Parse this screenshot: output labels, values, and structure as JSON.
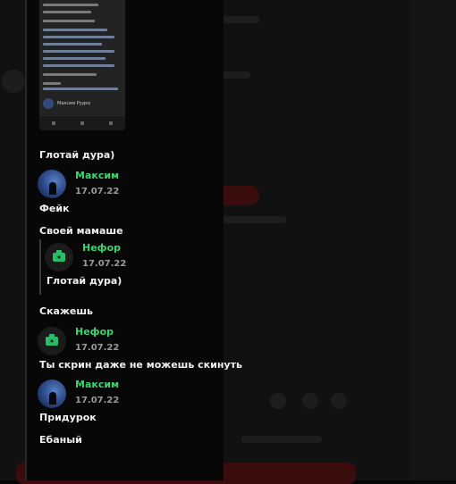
{
  "screenshot_post": {
    "author": "Максим Рудко"
  },
  "comments": [
    {
      "kind": "text",
      "text": "Глотай дура)"
    },
    {
      "kind": "header",
      "name": "Максим",
      "date": "17.07.22",
      "avatar": "photo"
    },
    {
      "kind": "text",
      "text": "Фейк"
    },
    {
      "kind": "text",
      "text": "Своей мамаше"
    },
    {
      "kind": "header",
      "name": "Нефор",
      "date": "17.07.22",
      "avatar": "camera-icon",
      "quoted": true
    },
    {
      "kind": "text",
      "text": "Глотай дура)",
      "quoted": true
    },
    {
      "kind": "text",
      "text": "Скажешь"
    },
    {
      "kind": "header",
      "name": "Нефор",
      "date": "17.07.22",
      "avatar": "camera-icon"
    },
    {
      "kind": "text",
      "text": "Ты скрин даже не можешь скинуть"
    },
    {
      "kind": "header",
      "name": "Максим",
      "date": "17.07.22",
      "avatar": "photo"
    },
    {
      "kind": "text",
      "text": "Придурок"
    },
    {
      "kind": "text",
      "text": "Ебаный"
    }
  ],
  "colors": {
    "name_accent": "#3bd46e",
    "camera_icon": "#26c06a",
    "date": "#9a9a9a",
    "background": "#060606"
  }
}
